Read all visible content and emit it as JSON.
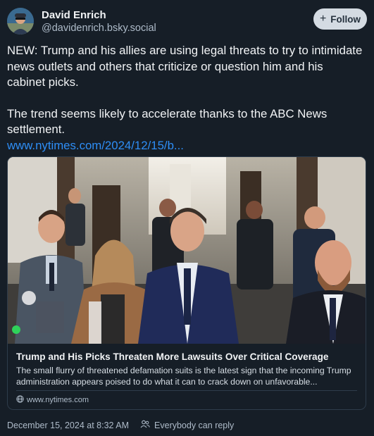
{
  "author": {
    "display_name": "David Enrich",
    "handle": "@davidenrich.bsky.social"
  },
  "follow_button": {
    "label": "Follow",
    "icon": "plus-icon"
  },
  "post": {
    "paragraph_1": "NEW: Trump and his allies are using legal threats to try to intimidate news outlets and others that criticize or question him and his cabinet picks.",
    "paragraph_2": "The trend seems likely to accelerate thanks to the ABC News settlement.",
    "link_text": "www.nytimes.com/2024/12/15/b..."
  },
  "link_card": {
    "title": "Trump and His Picks Threaten More Lawsuits Over Critical Coverage",
    "description": "The small flurry of threatened defamation suits is the latest sign that the incoming Trump administration appears poised to do what it can to crack down on unfavorable...",
    "domain": "www.nytimes.com",
    "domain_icon": "globe-icon"
  },
  "footer": {
    "timestamp": "December 15, 2024 at 8:32 AM",
    "reply_setting": "Everybody can reply",
    "reply_icon": "people-icon"
  },
  "colors": {
    "background": "#161e27",
    "link": "#2e8ef6",
    "muted_text": "#aebbc9",
    "follow_button_bg": "#d4dbe2"
  }
}
